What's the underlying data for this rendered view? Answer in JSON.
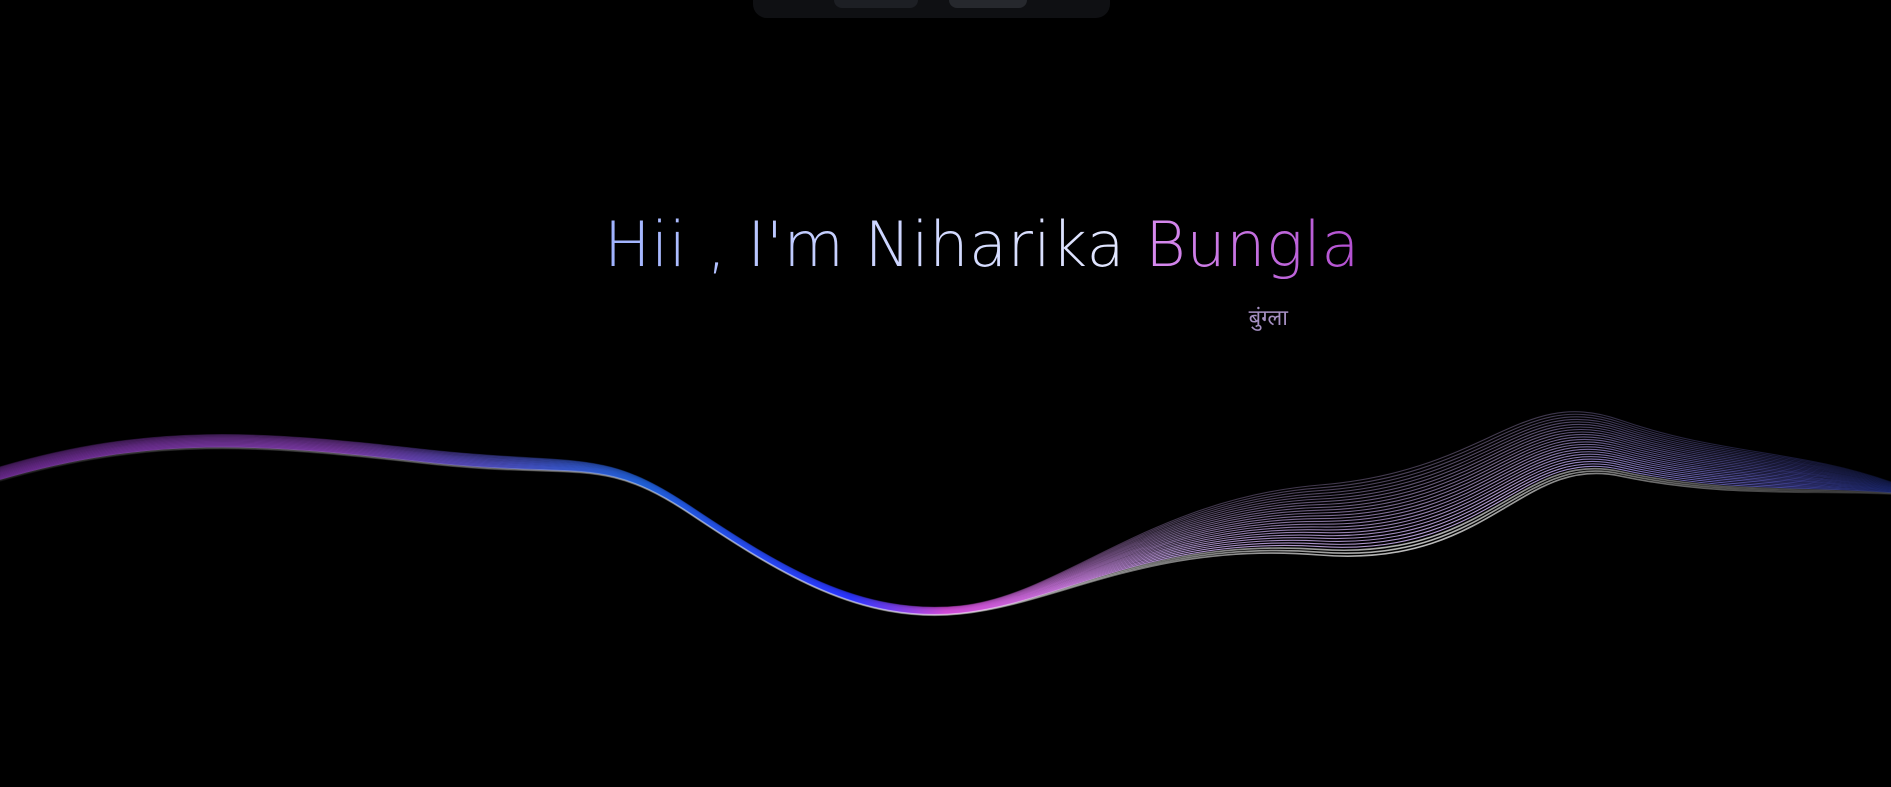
{
  "hero": {
    "greeting_first": "Hii , I'm Niharika ",
    "greeting_last": "Bungla",
    "pronunciation": "बुंग्ला"
  },
  "colors": {
    "background": "#000000",
    "name_gradient_start": "#9fb2ff",
    "name_gradient_end": "#e4e8ff",
    "surname_gradient_start": "#d88cf0",
    "surname_gradient_end": "#b34fd1",
    "wave_blue": "#2a3cff",
    "wave_purple": "#9d5cff",
    "wave_pink": "#e7c6ff"
  },
  "wave": {
    "strands": 26
  }
}
